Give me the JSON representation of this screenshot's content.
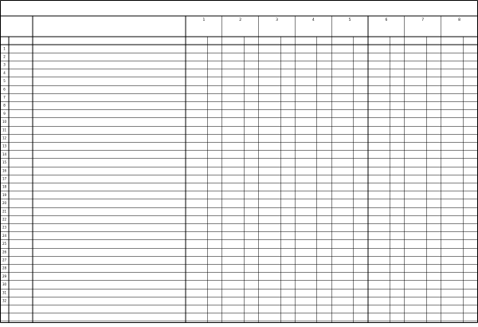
{
  "title": "",
  "column_groups": [
    {
      "label": "1"
    },
    {
      "label": "2"
    },
    {
      "label": "3"
    },
    {
      "label": "4"
    },
    {
      "label": "5"
    },
    {
      "label": "6"
    },
    {
      "label": "7"
    },
    {
      "label": "8"
    }
  ],
  "rows": [
    {
      "number": "1"
    },
    {
      "number": "2"
    },
    {
      "number": "3"
    },
    {
      "number": "4"
    },
    {
      "number": "5"
    },
    {
      "number": "6"
    },
    {
      "number": "7"
    },
    {
      "number": "8"
    },
    {
      "number": "9"
    },
    {
      "number": "10"
    },
    {
      "number": "11"
    },
    {
      "number": "12"
    },
    {
      "number": "13"
    },
    {
      "number": "14"
    },
    {
      "number": "15"
    },
    {
      "number": "16"
    },
    {
      "number": "17"
    },
    {
      "number": "18"
    },
    {
      "number": "19"
    },
    {
      "number": "20"
    },
    {
      "number": "21"
    },
    {
      "number": "22"
    },
    {
      "number": "23"
    },
    {
      "number": "24"
    },
    {
      "number": "25"
    },
    {
      "number": "26"
    },
    {
      "number": "27"
    },
    {
      "number": "28"
    },
    {
      "number": "29"
    },
    {
      "number": "30"
    },
    {
      "number": "31"
    },
    {
      "number": "32"
    },
    {
      "number": ""
    },
    {
      "number": ""
    },
    {
      "number": ""
    },
    {
      "number": ""
    }
  ],
  "colors": {
    "line": "#000000",
    "background": "#ffffff"
  }
}
